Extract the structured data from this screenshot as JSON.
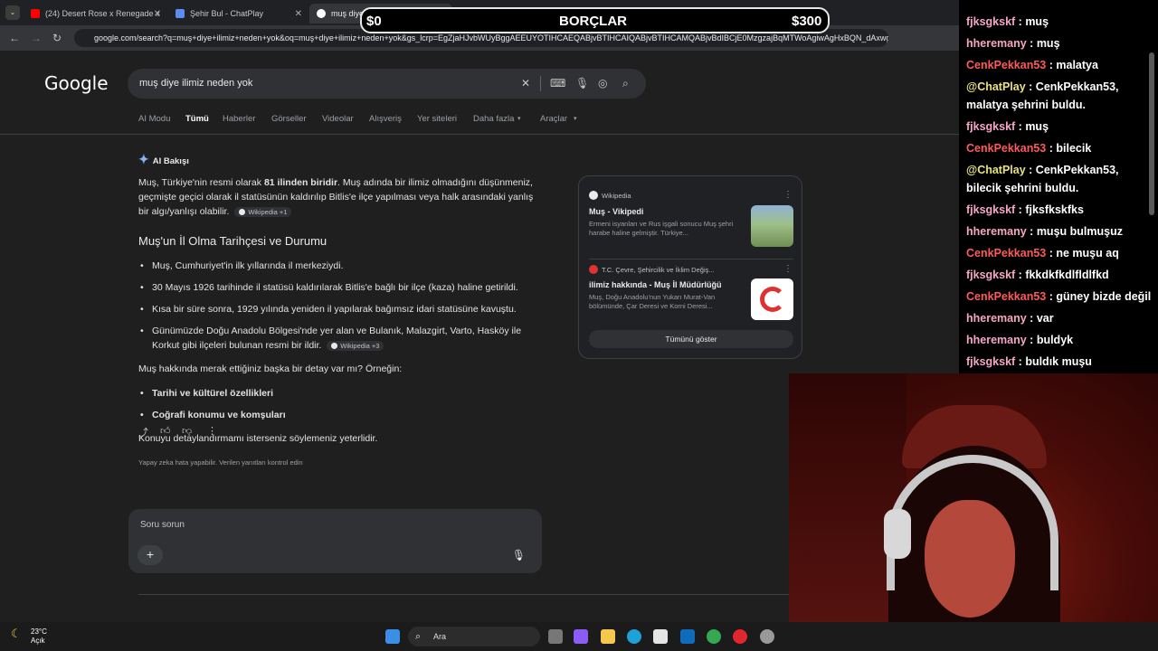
{
  "browser": {
    "tabs": [
      {
        "label": "(24) Desert Rose x Renegade x",
        "icon": "youtube-icon"
      },
      {
        "label": "Şehir Bul - ChatPlay",
        "icon": "chatplay-icon"
      },
      {
        "label": "muş diye ilimiz neden yok - Go",
        "icon": "google-icon"
      }
    ],
    "new_tab": "+",
    "url": "google.com/search?q=muş+diye+ilimiz+neden+yok&oq=muş+diye+ilimiz+neden+yok&gs_lcrp=EgZjaHJvbWUyBggAEEUYOTIHCAEQABjvBTIHCAIQABjvBTIHCAMQABjvBdIBCjE0MzgzajBqMTWoAgiwAgHxBQN_dAxwgc"
  },
  "overlay": {
    "left": "$0",
    "title": "BORÇLAR",
    "right": "$300"
  },
  "google": {
    "logo": "Google",
    "query": "muş diye ilimiz neden yok",
    "tabs": [
      "AI Modu",
      "Tümü",
      "Haberler",
      "Görseller",
      "Videolar",
      "Alışveriş",
      "Yer siteleri",
      "Daha fazla",
      "Araçlar"
    ],
    "ai": {
      "header": "AI Bakışı",
      "p1a": "Muş, Türkiye'nin resmi olarak ",
      "p1b": "81 ilinden biridir",
      "p1c": ". Muş adında bir ilimiz olmadığını düşünmeniz, geçmişte geçici olarak il statüsünün kaldırılıp Bitlis'e ilçe yapılması veya halk arasındaki yanlış bir algı/yanlışı olabilir.",
      "chip1": "Wikipedia +1",
      "heading": "Muş'un İl Olma Tarihçesi ve Durumu",
      "bullets": [
        "Muş, Cumhuriyet'in ilk yıllarında il merkeziydi.",
        "30 Mayıs 1926 tarihinde il statüsü kaldırılarak Bitlis'e bağlı bir ilçe (kaza) haline getirildi.",
        "Kısa bir süre sonra, 1929 yılında yeniden il yapılarak bağımsız idari statüsüne kavuştu.",
        "Günümüzde Doğu Anadolu Bölgesi'nde yer alan ve Bulanık, Malazgirt, Varto, Hasköy ile Korkut gibi ilçeleri bulunan resmi bir ildir."
      ],
      "chip2": "Wikipedia +3",
      "p2": "Muş hakkında merak ettiğiniz başka bir detay var mı? Örneğin:",
      "bold_bullets": [
        "Tarihi ve kültürel özellikleri",
        "Coğrafi konumu ve komşuları"
      ],
      "p3": "Konuyu detaylandırmamı isterseniz söylemeniz yeterlidir.",
      "note": "Yapay zeka hata yapabilir. Verilen yanıtları kontrol edin"
    },
    "ask_placeholder": "Soru sorun",
    "panel": {
      "items": [
        {
          "source": "Wikipedia",
          "title": "Muş - Vikipedi",
          "desc": "Ermeni isyanları ve Rus işgali sonucu Muş şehri harabe haline gelmiştir. Türkiye..."
        },
        {
          "source": "T.C. Çevre, Şehircilik ve İklim Değiş...",
          "title": "ilimiz hakkında - Muş İl Müdürlüğü",
          "desc": "Muş, Doğu Anadolu'nun Yukarı Murat-Van bölümünde, Çar Deresi ve Korni Deresi..."
        }
      ],
      "show_all": "Tümünü göster"
    }
  },
  "taskbar": {
    "temp": "23°C",
    "weather": "Açık",
    "search": "Ara"
  },
  "chat": [
    {
      "user": "fjksgkskf",
      "text": "muş",
      "color": "#f6a5c6"
    },
    {
      "user": "hheremany",
      "text": "muş",
      "color": "#f6a5c6"
    },
    {
      "user": "CenkPekkan53",
      "text": "malatya",
      "color": "#ff5a5a"
    },
    {
      "user": "@ChatPlay",
      "text": "CenkPekkan53,",
      "line2": "malatya şehrini buldu.",
      "color": "#e8e37a"
    },
    {
      "user": "fjksgkskf",
      "text": "muş",
      "color": "#f6a5c6"
    },
    {
      "user": "CenkPekkan53",
      "text": "bilecik",
      "color": "#ff5a5a"
    },
    {
      "user": "@ChatPlay",
      "text": "CenkPekkan53,",
      "line2": "bilecik şehrini buldu.",
      "color": "#e8e37a"
    },
    {
      "user": "fjksgkskf",
      "text": "fjksfkskfks",
      "color": "#f6a5c6"
    },
    {
      "user": "hheremany",
      "text": "muşu bulmuşuz",
      "color": "#f6a5c6"
    },
    {
      "user": "CenkPekkan53",
      "text": "ne muşu aq",
      "color": "#ff5a5a"
    },
    {
      "user": "fjksgkskf",
      "text": "fkkdkfkdlfldlfkd",
      "color": "#f6a5c6"
    },
    {
      "user": "CenkPekkan53",
      "text": "güney bizde değil",
      "color": "#ff5a5a"
    },
    {
      "user": "hheremany",
      "text": "var",
      "color": "#f6a5c6"
    },
    {
      "user": "hheremany",
      "text": "buldyk",
      "color": "#f6a5c6"
    },
    {
      "user": "fjksgkskf",
      "text": "buldık muşu",
      "color": "#f6a5c6"
    }
  ]
}
